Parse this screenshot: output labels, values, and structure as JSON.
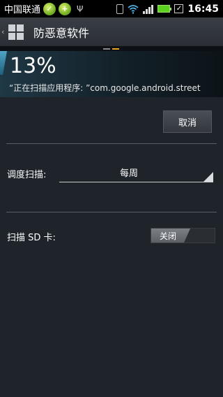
{
  "status_bar": {
    "carrier": "中国联通",
    "time": "16:45",
    "icons": [
      "app-badge-icon",
      "app-plus-icon",
      "usb-icon",
      "vibrate-icon",
      "wifi-icon",
      "signal-icon",
      "battery-icon",
      "check-icon"
    ]
  },
  "action_bar": {
    "title": "防恶意软件"
  },
  "progress": {
    "percent_text": "13%",
    "status_text": "“正在扫描应用程序: ”com.google.android.street"
  },
  "buttons": {
    "cancel": "取消"
  },
  "schedule": {
    "label": "调度扫描:",
    "value": "每周"
  },
  "sdcard": {
    "label": "扫描 SD 卡:",
    "toggle_label": "关闭"
  },
  "colors": {
    "accent": "#4fa4c6",
    "battery": "#5bd21d",
    "indicator_active": "#e8a318"
  }
}
